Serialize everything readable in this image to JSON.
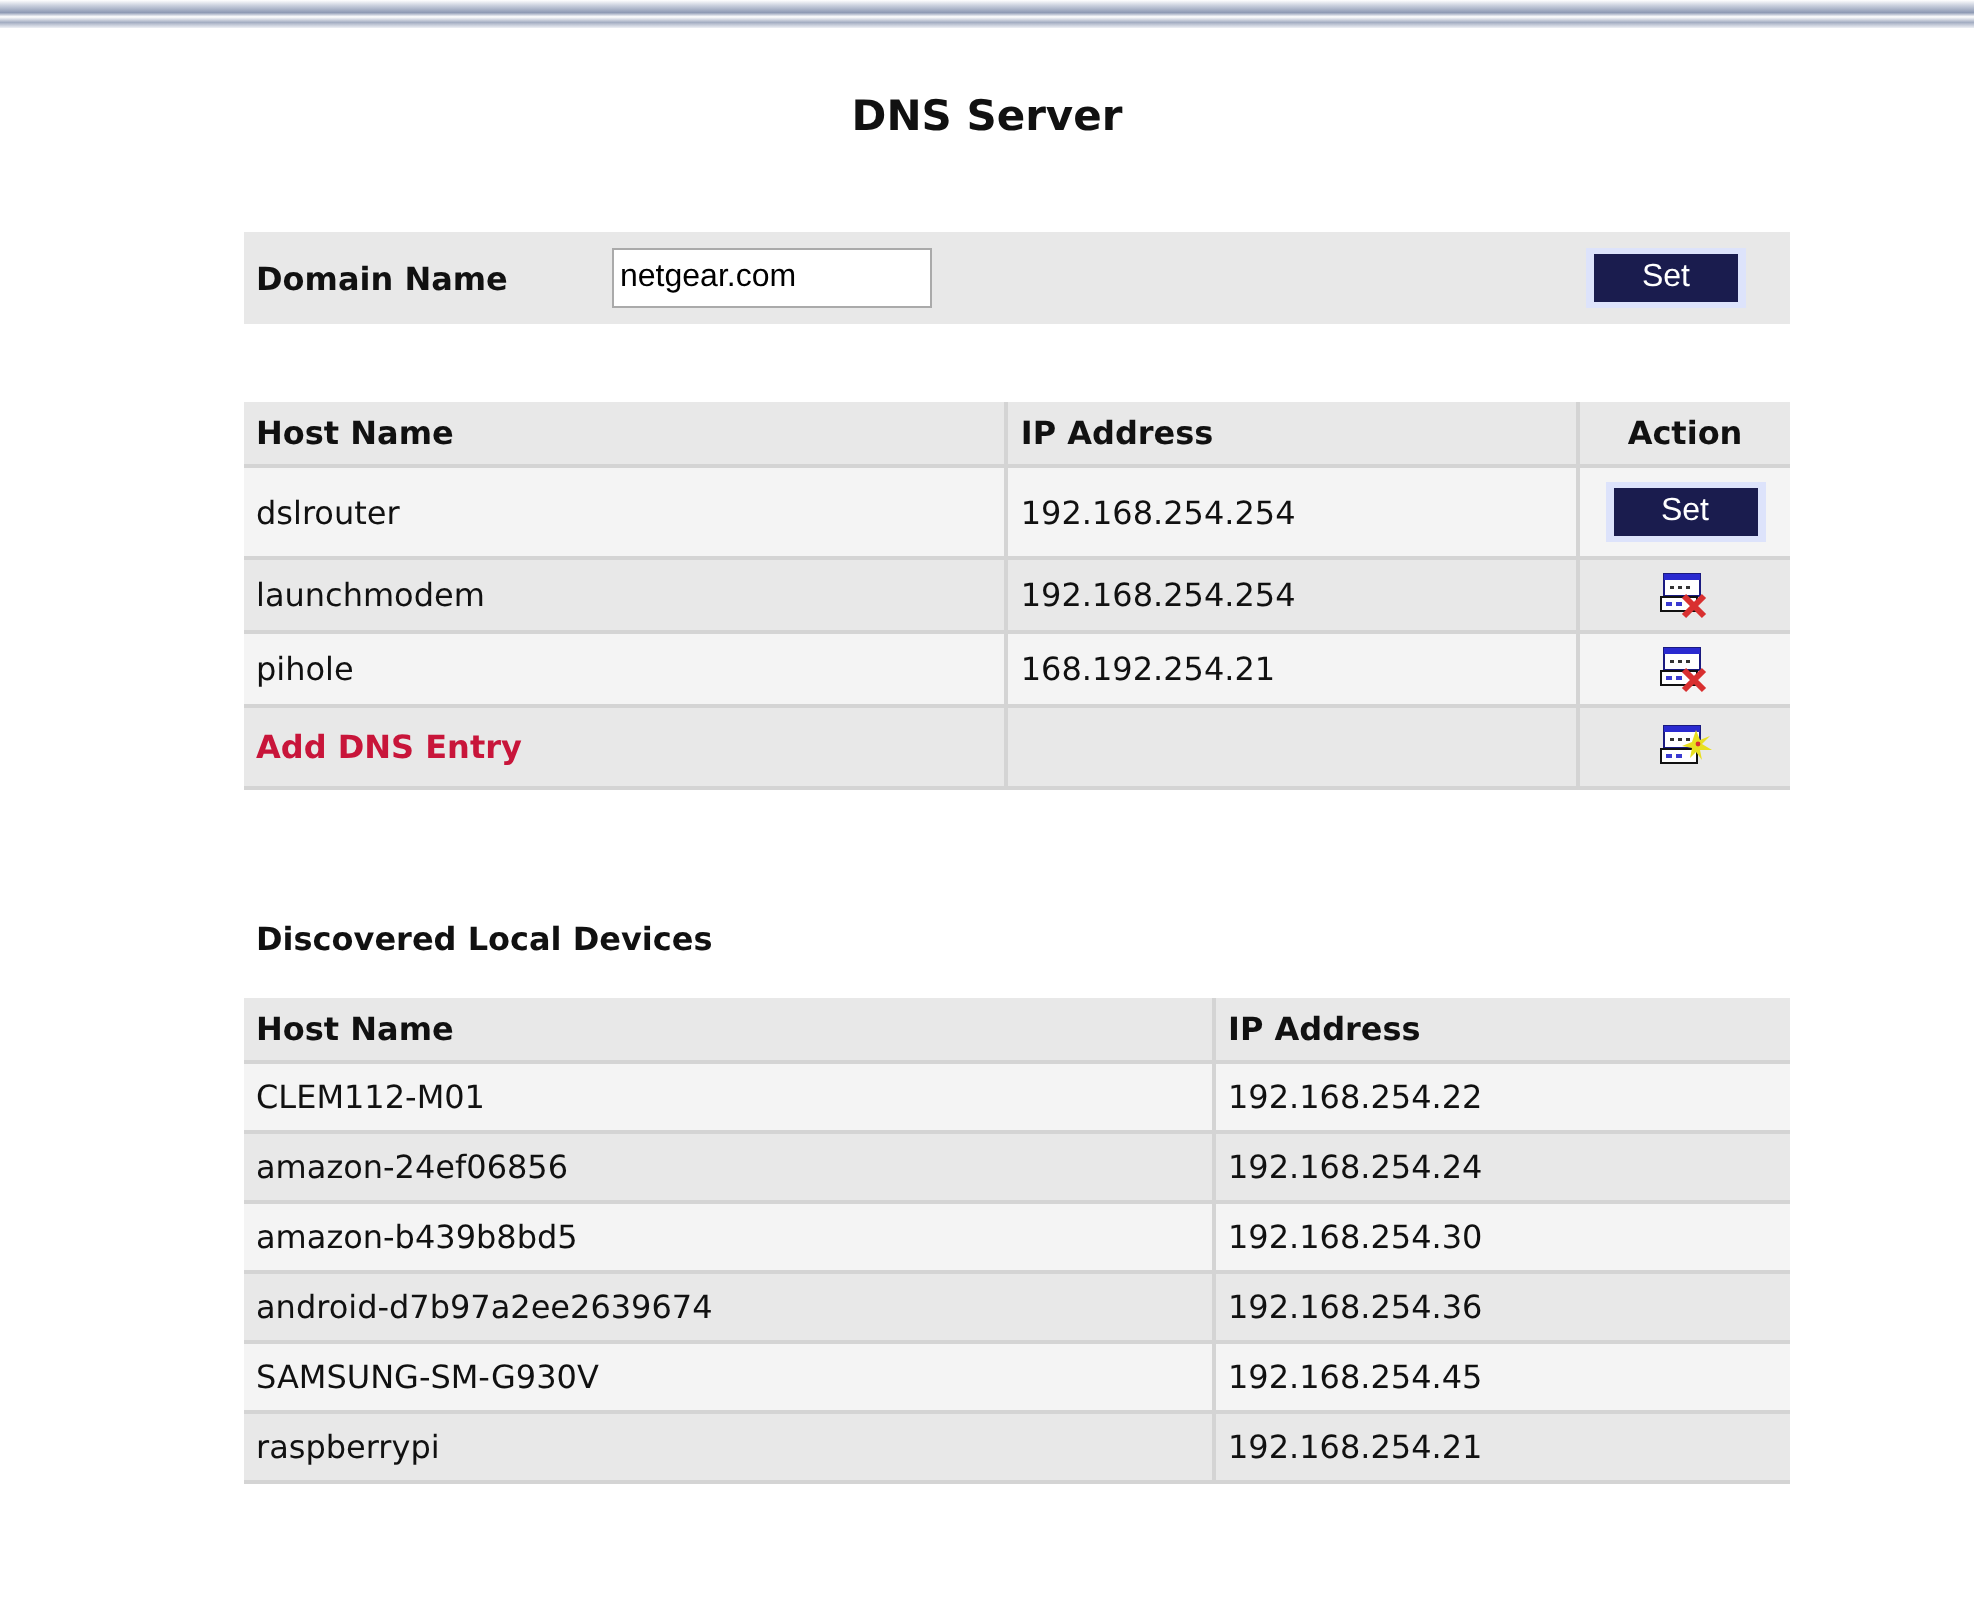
{
  "title": "DNS Server",
  "domain": {
    "label": "Domain Name",
    "value": "netgear.com",
    "button": "Set"
  },
  "dns_table": {
    "columns": [
      "Host Name",
      "IP Address",
      "Action"
    ],
    "rows": [
      {
        "host": "dslrouter",
        "ip": "192.168.254.254",
        "action": {
          "kind": "button",
          "label": "Set"
        }
      },
      {
        "host": "launchmodem",
        "ip": "192.168.254.254",
        "action": {
          "kind": "delete"
        }
      },
      {
        "host": "pihole",
        "ip": "168.192.254.21",
        "action": {
          "kind": "delete"
        }
      }
    ],
    "add_entry": {
      "label": "Add DNS Entry"
    }
  },
  "devices": {
    "heading": "Discovered Local Devices",
    "columns": [
      "Host Name",
      "IP Address"
    ],
    "rows": [
      {
        "host": "CLEM112-M01",
        "ip": "192.168.254.22"
      },
      {
        "host": "amazon-24ef06856",
        "ip": "192.168.254.24"
      },
      {
        "host": "amazon-b439b8bd5",
        "ip": "192.168.254.30"
      },
      {
        "host": "android-d7b97a2ee2639674",
        "ip": "192.168.254.36"
      },
      {
        "host": "SAMSUNG-SM-G930V",
        "ip": "192.168.254.45"
      },
      {
        "host": "raspberrypi",
        "ip": "192.168.254.21"
      }
    ]
  }
}
